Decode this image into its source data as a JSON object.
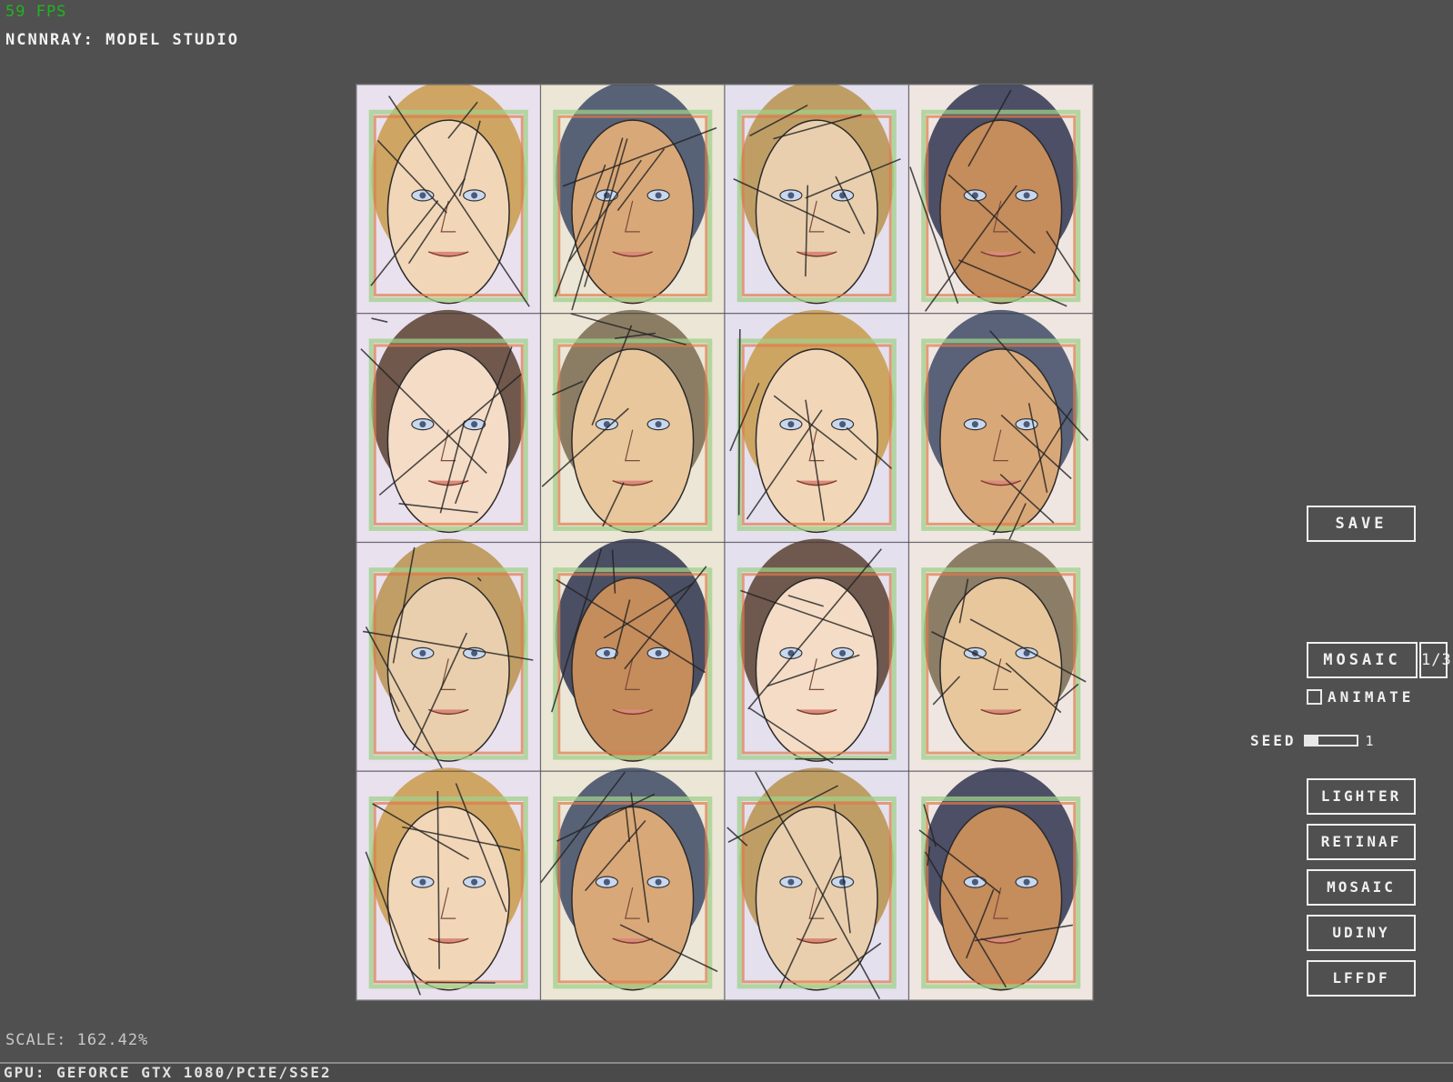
{
  "fps": "59 FPS",
  "title": "NCNNRAY: MODEL STUDIO",
  "canvas": {
    "description_icon": "mosaic-faces-image",
    "grid_rows": 4,
    "grid_cols": 4
  },
  "actions": {
    "save_label": "SAVE",
    "mode_label": "MOSAIC",
    "mode_page": "1/3",
    "animate_label": "ANIMATE",
    "animate_checked": false,
    "seed_label": "SEED",
    "seed_value": "1",
    "seed_level": 0.25
  },
  "models": [
    {
      "label": "LIGHTER"
    },
    {
      "label": "RETINAF"
    },
    {
      "label": "MOSAIC"
    },
    {
      "label": "UDINY"
    },
    {
      "label": "LFFDF"
    }
  ],
  "scale_text": "SCALE: 162.42%",
  "gpu_text": "GPU: GEFORCE GTX 1080/PCIE/SSE2",
  "colors": {
    "background": "#505050",
    "fps": "#1fb51f",
    "text": "#f0f0f0"
  }
}
